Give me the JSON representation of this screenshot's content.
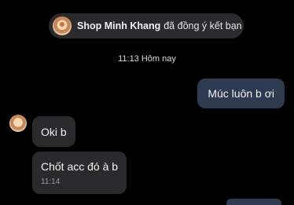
{
  "system_message": {
    "shop_name": "Shop Minh Khang",
    "text": "đã đồng ý kết bạn"
  },
  "timestamp": "11:13 Hôm nay",
  "messages": [
    {
      "direction": "outgoing",
      "text": "Múc luôn b ơi"
    },
    {
      "direction": "incoming",
      "text": "Oki b"
    },
    {
      "direction": "incoming",
      "text": "Chốt acc đó à b",
      "time": "11:14"
    }
  ]
}
